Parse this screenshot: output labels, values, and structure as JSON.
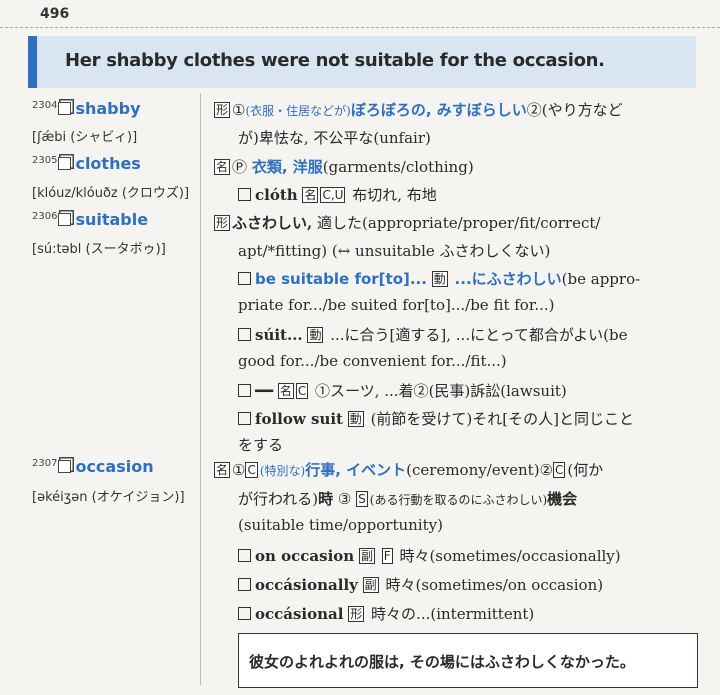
{
  "page_number": "496",
  "banner": {
    "sentence": "Her shabby clothes were not suitable for the occasion."
  },
  "headwords": [
    {
      "num": "2304",
      "word": "shabby",
      "ipa": "[ʃǽbi (シャビィ)]"
    },
    {
      "num": "2305",
      "word": "clothes",
      "ipa": "[klóuz/klóuðz (クロウズ)]"
    },
    {
      "num": "2306",
      "word": "suitable",
      "ipa": "[sú:təbl (スータボゥ)]"
    },
    {
      "num": "2307",
      "word": "occasion",
      "ipa": "[əkéiʒən (オケイジョン)]"
    }
  ],
  "entries": {
    "shabby": {
      "tag": "形",
      "line1_sense": "①",
      "line1_paren": "(衣服・住居などが)",
      "line1_def": "ぼろぼろの, みすぼらしい",
      "line1_sense2": "②",
      "line1_tail": "(やり方など",
      "line2": "が)卑怯な, 不公平な(unfair)"
    },
    "clothes": {
      "tag": "名",
      "plural": "Ⓟ",
      "def": "衣類, 洋服",
      "gloss": "(garments/clothing)",
      "sub_word": "clóth",
      "sub_tag": "名",
      "sub_cu": "C,U",
      "sub_def": "布切れ, 布地"
    },
    "suitable": {
      "tag": "形",
      "line1_def": "ふさわしい,",
      "line1_rest": "適した(appropriate/proper/fit/correct/",
      "line2": "apt/*fitting) (↔ unsuitable ふさわしくない)",
      "phrase1": "be suitable for[to]...",
      "phrase1_tag": "動",
      "phrase1_def": "...にふさわしい",
      "phrase1_rest": "(be appro-",
      "phrase1_line2": "priate for.../be suited for[to].../be fit for...)",
      "phrase2": "súit...",
      "phrase2_tag": "動",
      "phrase2_def": "...に合う[適する], ...にとって都合がよい(be",
      "phrase2_line2": "good for.../be convenient for.../fit...)",
      "phrase3_dash": "━━",
      "phrase3_tag": "名",
      "phrase3_c": "C",
      "phrase3_def": "①スーツ, ...着②(民事)訴訟(lawsuit)",
      "phrase4": "follow suit",
      "phrase4_tag": "動",
      "phrase4_def": "(前節を受けて)それ[その人]と同じこと",
      "phrase4_line2": "をする"
    },
    "occasion": {
      "tag": "名",
      "line1_sense": "①",
      "line1_c": "C",
      "line1_paren": "(特別な)",
      "line1_def": "行事, イベント",
      "line1_rest": "(ceremony/event)",
      "line1_sense2": "②",
      "line1_c2": "C",
      "line1_tail": "(何か",
      "line2_pre": "が行われる)",
      "line2_def": "時",
      "line2_sense3": "③",
      "line2_s": "S",
      "line2_paren": "(ある行動を取るのにふさわしい)",
      "line2_def2": "機会",
      "line3": "(suitable time/opportunity)",
      "sub1_word": "on occasion",
      "sub1_tag": "副",
      "sub1_f": "F",
      "sub1_def": "時々(sometimes/occasionally)",
      "sub2_word": "occásionally",
      "sub2_tag": "副",
      "sub2_def": "時々(sometimes/on occasion)",
      "sub3_word": "occásional",
      "sub3_tag": "形",
      "sub3_def": "時々の...(intermittent)"
    }
  },
  "translation": "彼女のよれよれの服は, その場にはふさわしくなかった。",
  "colors": {
    "accent": "#2f6fc0",
    "banner_bg": "#d9e6f2"
  }
}
